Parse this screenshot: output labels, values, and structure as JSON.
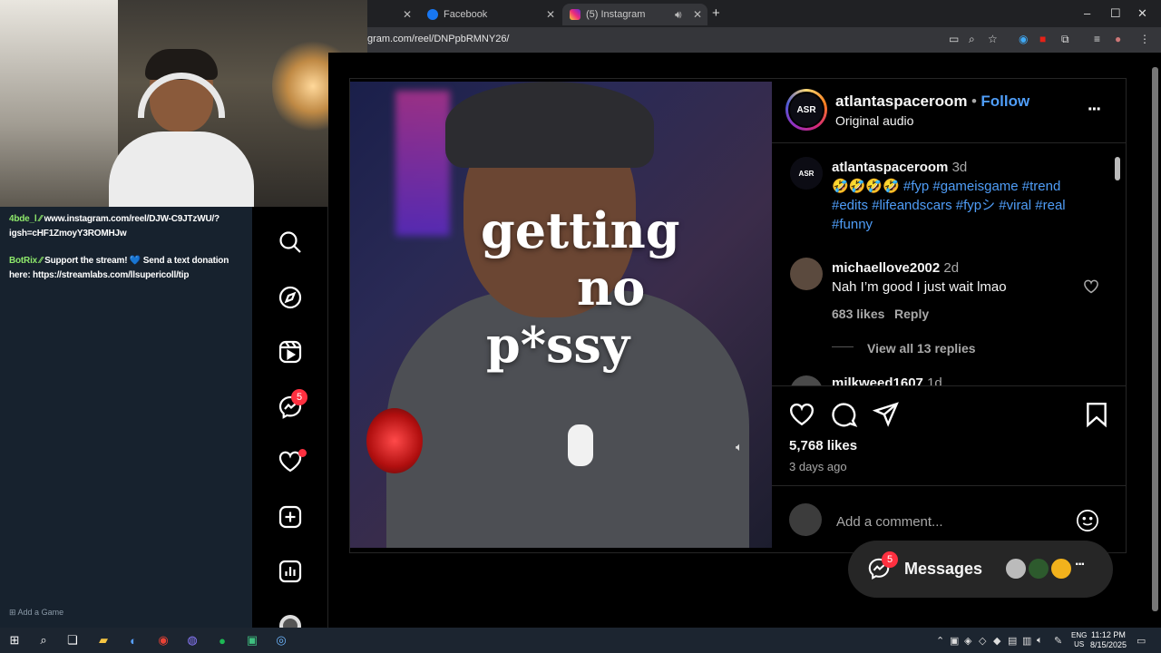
{
  "browser": {
    "tabs": [
      {
        "label": "",
        "active": false
      },
      {
        "label": "Facebook",
        "active": false
      },
      {
        "label": "(5) Instagram",
        "active": true
      }
    ],
    "url": "gram.com/reel/DNPpbRMNY26/",
    "window_controls": [
      "–",
      "☐",
      "✕"
    ],
    "new_tab": "+"
  },
  "chat": {
    "messages": [
      {
        "user": "4bde_l",
        "text": " www.instagram.com/reel/DJW-C9JTzWU/?igsh=cHF1ZmoyY3ROMHJw"
      },
      {
        "user": "BotRix",
        "text": " Support the stream! 💙 Send a text donation here: https://streamlabs.com/llsupericoll/tip"
      }
    ],
    "add_game": "Add a Game"
  },
  "nav": {
    "messenger_badge": "5",
    "items": [
      "search-icon",
      "explore-icon",
      "reels-icon",
      "messenger-icon",
      "heart-icon",
      "create-icon",
      "dashboard-icon",
      "profile-icon"
    ]
  },
  "video": {
    "caption_lines": [
      "getting",
      "no",
      "p*ssy"
    ]
  },
  "post": {
    "author": "atlantaspaceroom",
    "avatar_text": "ASR",
    "follow": "Follow",
    "separator": "•",
    "audio": "Original audio",
    "more": "···",
    "caption": {
      "author": "atlantaspaceroom",
      "age": "3d",
      "emoji": "🤣🤣🤣🤣",
      "hashtags_line1": "#fyp #gameisgame #trend",
      "hashtags_line2": "#edits #lifeandscars #fypシ #viral #real",
      "hashtags_line3": "#funny"
    },
    "comments": [
      {
        "user": "michaellove2002",
        "age": "2d",
        "text": "Nah I’m good I just wait lmao",
        "likes": "683 likes",
        "reply": "Reply",
        "view_replies": "View all 13 replies"
      },
      {
        "user": "milkweed1607",
        "age": "1d"
      }
    ],
    "likes": "5,768 likes",
    "posted": "3 days ago",
    "add_comment_placeholder": "Add a comment..."
  },
  "messages_bar": {
    "label": "Messages",
    "badge": "5",
    "more": "···"
  },
  "taskbar": {
    "lang_top": "ENG",
    "lang_bottom": "US",
    "time": "11:12 PM",
    "date": "8/15/2025"
  },
  "colors": {
    "accent_blue": "#4f9df7",
    "badge_red": "#ff3040",
    "background": "#000000"
  }
}
